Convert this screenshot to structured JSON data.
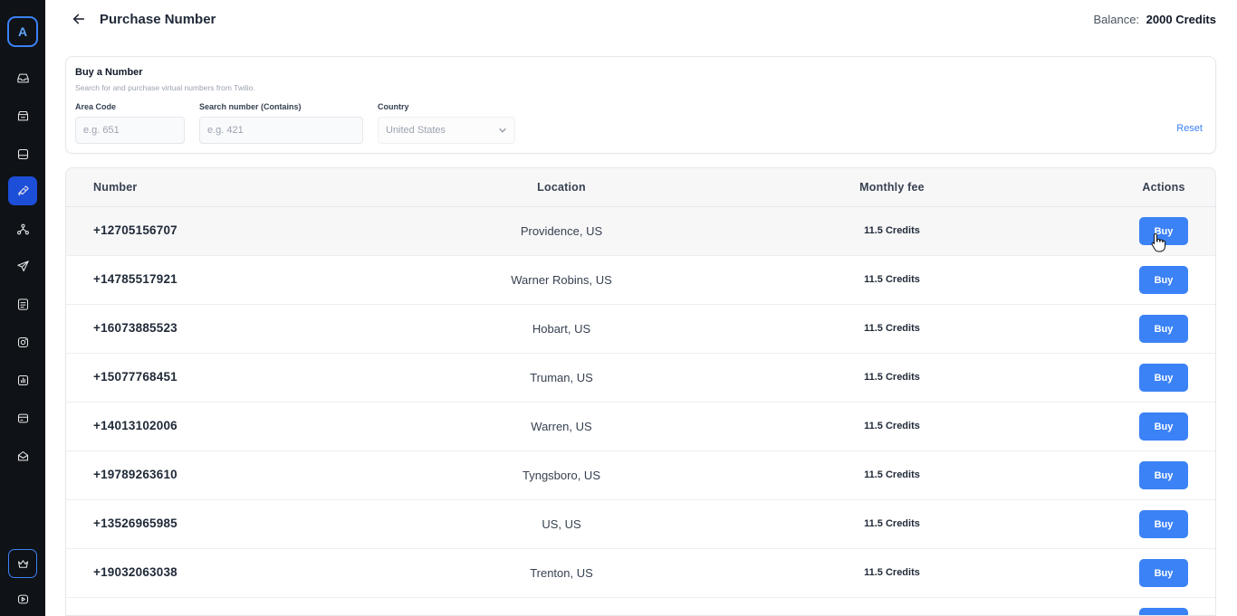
{
  "sidebar": {
    "logo_letter": "A",
    "items": [
      {
        "icon": "inbox-icon"
      },
      {
        "icon": "archive-icon"
      },
      {
        "icon": "storage-icon"
      },
      {
        "icon": "satellite-icon",
        "active": true
      },
      {
        "icon": "network-icon"
      },
      {
        "icon": "send-icon"
      },
      {
        "icon": "document-icon"
      },
      {
        "icon": "instagram-icon"
      },
      {
        "icon": "analytics-icon"
      },
      {
        "icon": "card-icon"
      },
      {
        "icon": "mail-open-icon"
      }
    ],
    "bottom_items": [
      {
        "icon": "crown-icon"
      },
      {
        "icon": "video-icon"
      }
    ]
  },
  "header": {
    "title": "Purchase Number",
    "balance_label": "Balance:",
    "balance_value": "2000 Credits"
  },
  "search": {
    "title": "Buy a Number",
    "subtitle": "Search for and purchase virtual numbers from Twilio.",
    "area_code_label": "Area Code",
    "area_code_placeholder": "e.g. 651",
    "search_label": "Search number (Contains)",
    "search_placeholder": "e.g. 421",
    "country_label": "Country",
    "country_value": "United States",
    "reset_label": "Reset"
  },
  "table": {
    "headers": [
      "Number",
      "Location",
      "Monthly fee",
      "Actions"
    ],
    "buy_label": "Buy",
    "rows": [
      {
        "number": "+12705156707",
        "location": "Providence, US",
        "fee": "11.5 Credits"
      },
      {
        "number": "+14785517921",
        "location": "Warner Robins, US",
        "fee": "11.5 Credits"
      },
      {
        "number": "+16073885523",
        "location": "Hobart, US",
        "fee": "11.5 Credits"
      },
      {
        "number": "+15077768451",
        "location": "Truman, US",
        "fee": "11.5 Credits"
      },
      {
        "number": "+14013102006",
        "location": "Warren, US",
        "fee": "11.5 Credits"
      },
      {
        "number": "+19789263610",
        "location": "Tyngsboro, US",
        "fee": "11.5 Credits"
      },
      {
        "number": "+13526965985",
        "location": "US, US",
        "fee": "11.5 Credits"
      },
      {
        "number": "+19032063038",
        "location": "Trenton, US",
        "fee": "11.5 Credits"
      }
    ]
  },
  "colors": {
    "accent": "#3b82f6",
    "sidebar_bg": "#0f1216",
    "active_nav": "#1d4ed8"
  }
}
